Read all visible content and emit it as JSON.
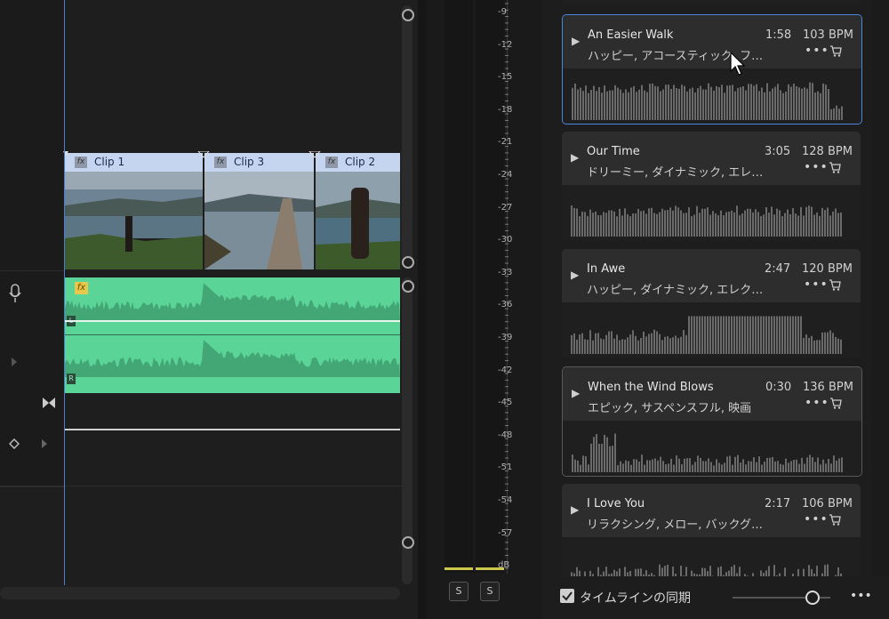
{
  "timeline": {
    "clips": [
      {
        "label": "Clip 1",
        "fx": "fx"
      },
      {
        "label": "Clip 3",
        "fx": "fx"
      },
      {
        "label": "Clip 2",
        "fx": "fx"
      }
    ],
    "audio_fx": "fx",
    "channel_left": "L",
    "channel_right": "R"
  },
  "meter": {
    "db_labels": [
      "-9",
      "-12",
      "-15",
      "-18",
      "-21",
      "-24",
      "-27",
      "-30",
      "-33",
      "-36",
      "-39",
      "-42",
      "-45",
      "-48",
      "-51",
      "-54",
      "-57",
      "dB"
    ],
    "solo_buttons": [
      "S",
      "S"
    ]
  },
  "music": {
    "tracks": [
      {
        "title": "An Easier Walk",
        "tags": "ハッピー, アコースティック, フォーク",
        "duration": "1:58",
        "bpm": "103 BPM",
        "more": "•••"
      },
      {
        "title": "Our Time",
        "tags": "ドリーミー, ダイナミック, エレクト...",
        "duration": "3:05",
        "bpm": "128 BPM",
        "more": "•••"
      },
      {
        "title": "In Awe",
        "tags": "ハッピー, ダイナミック, エレクトロ...",
        "duration": "2:47",
        "bpm": "120 BPM",
        "more": "•••"
      },
      {
        "title": "When the Wind Blows",
        "tags": "エピック, サスペンスフル, 映画",
        "duration": "0:30",
        "bpm": "136 BPM",
        "more": "•••"
      },
      {
        "title": "I Love You",
        "tags": "リラクシング, メロー, バックグラウ...",
        "duration": "2:17",
        "bpm": "106 BPM",
        "more": "•••"
      }
    ],
    "sync_label": "タイムラインの同期",
    "sync_checked": true,
    "footer_more": "•••"
  },
  "colors": {
    "accent_blue": "#4a87dd",
    "audio_green": "#5bd498",
    "clip_header": "#c6d5ef"
  }
}
